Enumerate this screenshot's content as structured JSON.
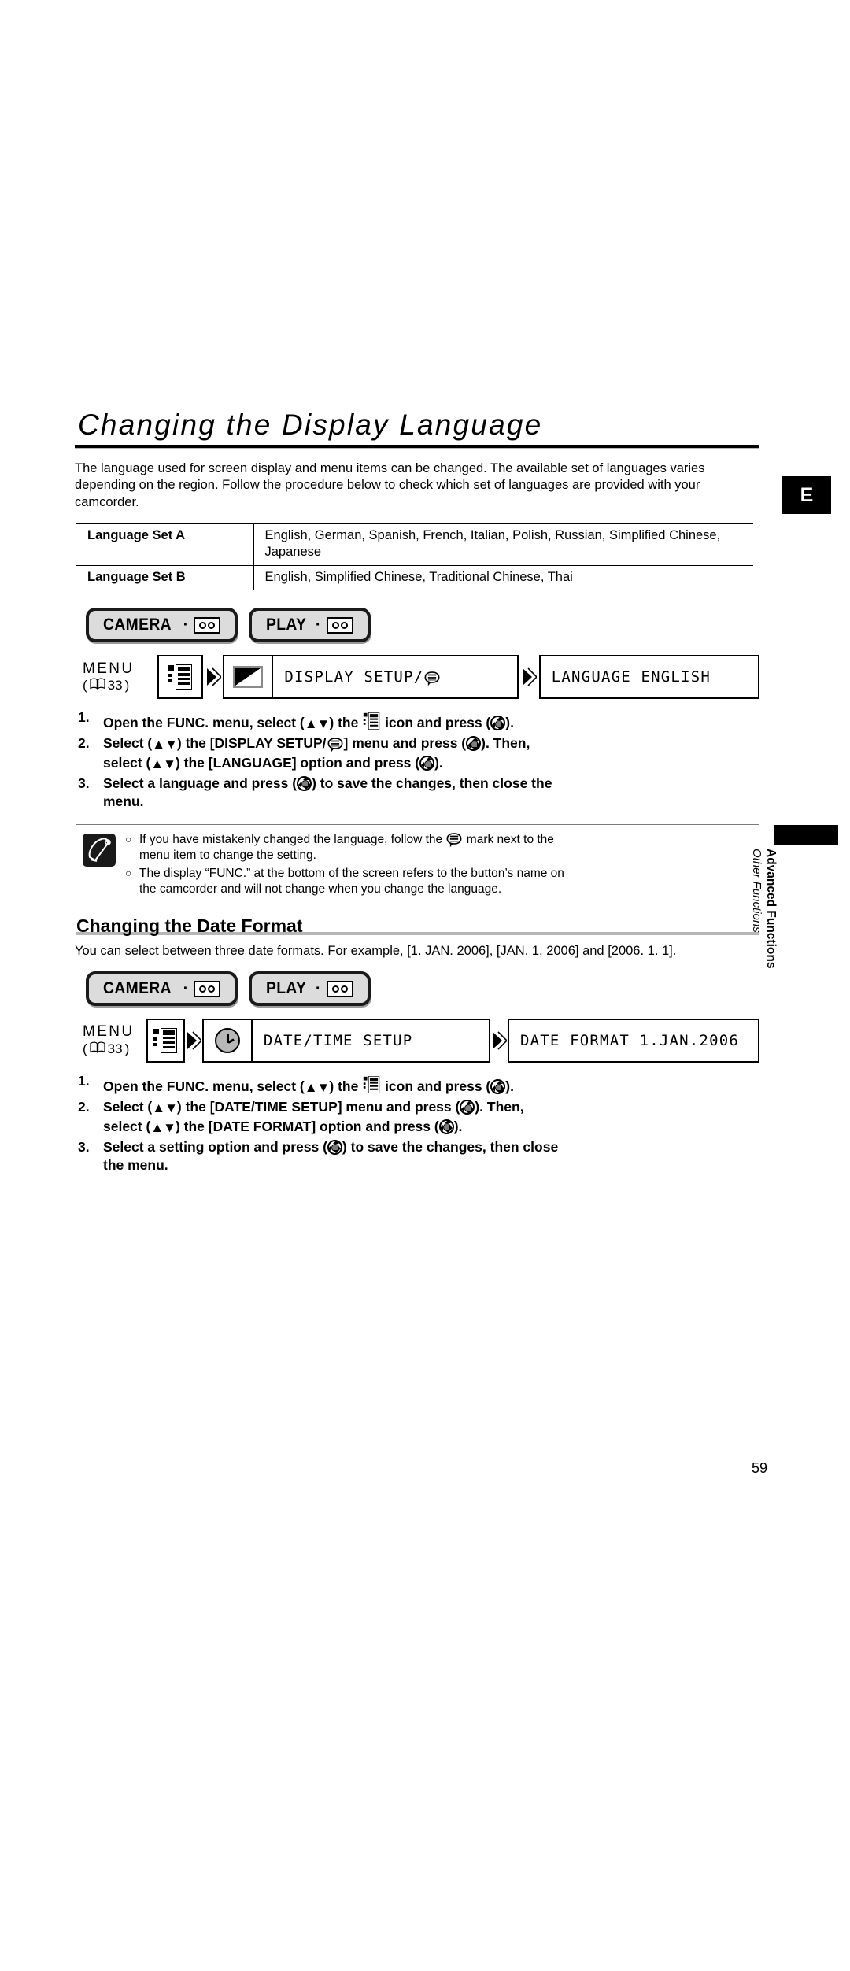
{
  "document": {
    "page_number": "59",
    "side_tab_letter": "E",
    "side_tab_line1": "Advanced Functions",
    "side_tab_line2": "Other Functions"
  },
  "section_language": {
    "title": "Changing the Display Language",
    "intro": "The language used for screen display and menu items can be changed. The available set of languages varies depending on the region. Follow the procedure below to check which set of languages are provided with your camcorder.",
    "table": {
      "rows": [
        {
          "label": "Language Set A",
          "value": "English, German, Spanish, French, Italian, Polish, Russian, Simplified Chinese, Japanese"
        },
        {
          "label": "Language Set B",
          "value": "English, Simplified Chinese, Traditional Chinese, Thai"
        }
      ]
    },
    "modes": [
      {
        "label": "CAMERA",
        "icon": "tape-icon"
      },
      {
        "label": "PLAY",
        "icon": "tape-icon"
      }
    ],
    "flow": {
      "menu_word": "MENU",
      "page_ref": "33",
      "menu_icon": "func-menu-icon",
      "box1_icon": "display-setup-icon",
      "box1_label": "DISPLAY SETUP/",
      "box2_label": "LANGUAGE ENGLISH"
    },
    "steps": [
      {
        "num": "1.",
        "pre": "Open the FUNC. menu, select (",
        "mid": ") the ",
        "post": " icon and press (",
        "end": ")."
      },
      {
        "num": "2.",
        "l1a": "Select (",
        "l1b": ") the [DISPLAY SETUP/",
        "l1c": "] menu and press (",
        "l1d": "). Then,",
        "l2a": "select (",
        "l2b": ") the [LANGUAGE] option and press (",
        "l2c": ")."
      },
      {
        "num": "3.",
        "l1a": "Select a language and press (",
        "l1b": ") to save the changes, then close the",
        "l2": "menu."
      }
    ],
    "notes": [
      {
        "a": "If you have mistakenly changed the language, follow the ",
        "b": " mark next to the",
        "c": "menu item to change the setting."
      },
      {
        "a": "The display “FUNC.” at the bottom of the screen refers to the button’s name on",
        "c": "the camcorder and will not change when you change the language."
      }
    ]
  },
  "section_date": {
    "title": "Changing the Date Format",
    "intro": "You can select between three date formats. For example, [1. JAN. 2006], [JAN. 1, 2006] and [2006. 1. 1].",
    "modes": [
      {
        "label": "CAMERA",
        "icon": "tape-icon"
      },
      {
        "label": "PLAY",
        "icon": "tape-icon"
      }
    ],
    "flow": {
      "menu_word": "MENU",
      "page_ref": "33",
      "menu_icon": "func-menu-icon",
      "box1_icon": "clock-icon",
      "box1_label": "DATE/TIME SETUP",
      "box2_label": "DATE FORMAT 1.JAN.2006"
    },
    "steps": [
      {
        "num": "1.",
        "pre": "Open the FUNC. menu, select (",
        "mid": ") the ",
        "post": " icon and press (",
        "end": ")."
      },
      {
        "num": "2.",
        "l1a": "Select (",
        "l1b": ") the [DATE/TIME SETUP] menu and press (",
        "l1d": "). Then,",
        "l2a": "select (",
        "l2b": ") the [DATE FORMAT] option and press (",
        "l2c": ")."
      },
      {
        "num": "3.",
        "l1a": "Select a setting option and press (",
        "l1b": ") to save the changes, then close",
        "l2": "the menu."
      }
    ]
  },
  "glyphs": {
    "updown": "▲▼",
    "bullet": "○"
  }
}
